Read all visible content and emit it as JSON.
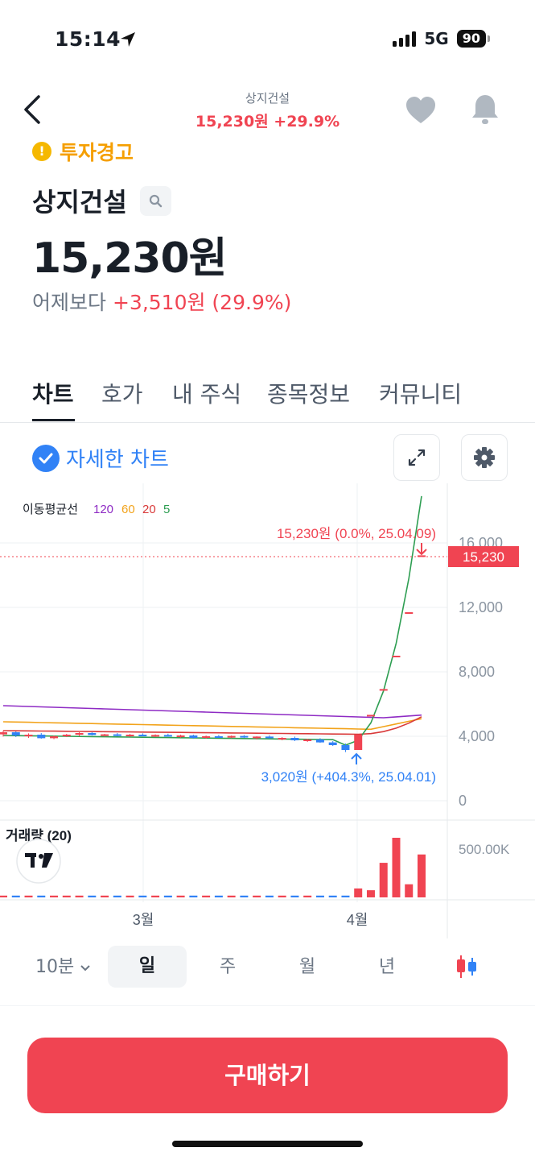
{
  "status": {
    "time": "15:14",
    "network": "5G",
    "battery": "90"
  },
  "header": {
    "stock_name": "상지건설",
    "price_change": "15,230원 +29.9%"
  },
  "warning": {
    "label": "투자경고",
    "icon": "!"
  },
  "stock": {
    "name": "상지건설",
    "price": "15,230원",
    "diff_label": "어제보다",
    "diff_value": "+3,510원 (29.9%)"
  },
  "tabs": [
    "차트",
    "호가",
    "내 주식",
    "종목정보",
    "커뮤니티"
  ],
  "chart_controls": {
    "detail_label": "자세한 차트",
    "detail_checked": true
  },
  "colors": {
    "up": "#f04452",
    "down": "#3182f6",
    "ma120": "#8e2bc4",
    "ma60": "#f2a31b",
    "ma20": "#d93a3a",
    "ma5": "#2e9e52",
    "warning": "#f59f00"
  },
  "chart_data": {
    "type": "candlestick",
    "ma_legend": {
      "label": "이동평균선",
      "periods": [
        "120",
        "60",
        "20",
        "5"
      ]
    },
    "y_ticks": [
      "16,000",
      "12,000",
      "8,000",
      "4,000",
      "0"
    ],
    "ylim": [
      0,
      16000
    ],
    "x_ticks": [
      "3월",
      "4월"
    ],
    "current_price_tag": "15,230",
    "current_price": 15230,
    "high_annotation": "15,230원 (0.0%, 25.04.09)",
    "low_annotation": "3,020원 (+404.3%, 25.04.01)",
    "candles": [
      {
        "o": 4120,
        "h": 4350,
        "l": 3980,
        "c": 4250
      },
      {
        "o": 4250,
        "h": 4300,
        "l": 3950,
        "c": 4050
      },
      {
        "o": 4050,
        "h": 4180,
        "l": 3900,
        "c": 4100
      },
      {
        "o": 4100,
        "h": 4200,
        "l": 3850,
        "c": 3880
      },
      {
        "o": 3880,
        "h": 4050,
        "l": 3820,
        "c": 4000
      },
      {
        "o": 4000,
        "h": 4150,
        "l": 3950,
        "c": 4100
      },
      {
        "o": 4100,
        "h": 4250,
        "l": 4000,
        "c": 4200
      },
      {
        "o": 4200,
        "h": 4260,
        "l": 4050,
        "c": 4080
      },
      {
        "o": 4080,
        "h": 4150,
        "l": 3980,
        "c": 4120
      },
      {
        "o": 4120,
        "h": 4200,
        "l": 4000,
        "c": 4020
      },
      {
        "o": 4020,
        "h": 4150,
        "l": 3960,
        "c": 4100
      },
      {
        "o": 4100,
        "h": 4180,
        "l": 4000,
        "c": 4050
      },
      {
        "o": 4050,
        "h": 4120,
        "l": 3950,
        "c": 4080
      },
      {
        "o": 4080,
        "h": 4160,
        "l": 3990,
        "c": 4000
      },
      {
        "o": 4000,
        "h": 4100,
        "l": 3900,
        "c": 4050
      },
      {
        "o": 4050,
        "h": 4100,
        "l": 3850,
        "c": 3900
      },
      {
        "o": 3900,
        "h": 4050,
        "l": 3850,
        "c": 4000
      },
      {
        "o": 4000,
        "h": 4080,
        "l": 3900,
        "c": 3950
      },
      {
        "o": 3950,
        "h": 4050,
        "l": 3880,
        "c": 4020
      },
      {
        "o": 4020,
        "h": 4080,
        "l": 3900,
        "c": 3920
      },
      {
        "o": 3920,
        "h": 4000,
        "l": 3800,
        "c": 3980
      },
      {
        "o": 3980,
        "h": 4060,
        "l": 3850,
        "c": 3880
      },
      {
        "o": 3880,
        "h": 3950,
        "l": 3750,
        "c": 3900
      },
      {
        "o": 3900,
        "h": 3980,
        "l": 3700,
        "c": 3750
      },
      {
        "o": 3750,
        "h": 3850,
        "l": 3650,
        "c": 3800
      },
      {
        "o": 3800,
        "h": 3880,
        "l": 3600,
        "c": 3620
      },
      {
        "o": 3620,
        "h": 3700,
        "l": 3400,
        "c": 3450
      },
      {
        "o": 3450,
        "h": 3550,
        "l": 3020,
        "c": 3150
      },
      {
        "o": 3150,
        "h": 4100,
        "l": 3150,
        "c": 4100
      },
      {
        "o": 5330,
        "h": 5330,
        "l": 5330,
        "c": 5330
      },
      {
        "o": 6930,
        "h": 6930,
        "l": 6930,
        "c": 6930
      },
      {
        "o": 9000,
        "h": 9000,
        "l": 9000,
        "c": 9000
      },
      {
        "o": 11700,
        "h": 11700,
        "l": 11700,
        "c": 11700
      },
      {
        "o": 15230,
        "h": 15230,
        "l": 15230,
        "c": 15230
      }
    ],
    "volume": {
      "label": "거래량 (20)",
      "y_tick": "500.00K"
    }
  },
  "periods": [
    "10분",
    "일",
    "주",
    "월",
    "년"
  ],
  "selected_period": "일",
  "buy_button": "구매하기"
}
